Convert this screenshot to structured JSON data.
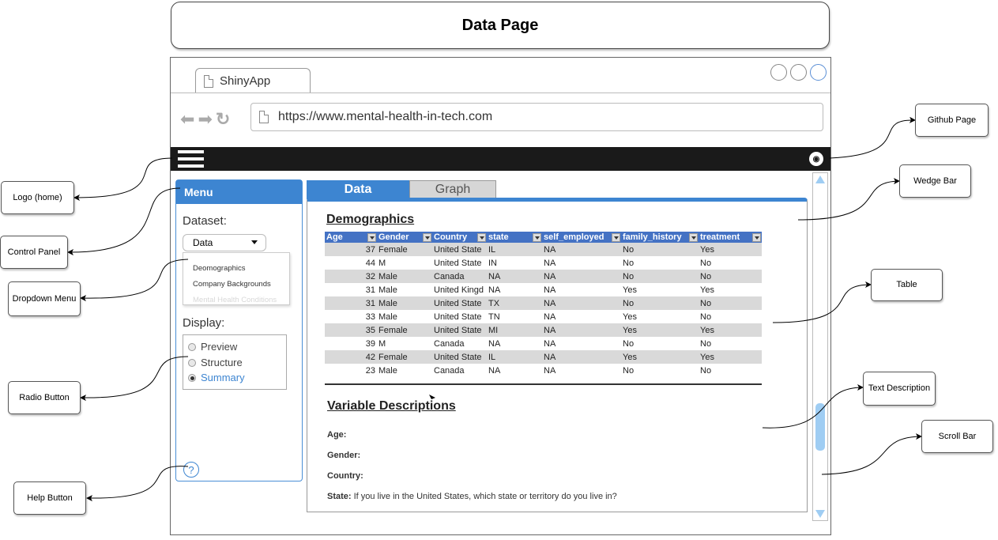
{
  "title": "Data Page",
  "browser": {
    "tab_label": "ShinyApp",
    "url": "https://www.mental-health-in-tech.com"
  },
  "menu": {
    "header": "Menu",
    "dataset_label": "Dataset:",
    "dataset_selected": "Data",
    "dropdown_options": [
      "Deomographics",
      "Company Backgrounds",
      "Mental Health Conditions"
    ],
    "display_label": "Display:",
    "radio_options": [
      "Preview",
      "Structure",
      "Summary"
    ],
    "radio_selected": "Summary",
    "help_symbol": "?"
  },
  "tabs": [
    "Data",
    "Graph"
  ],
  "active_tab": "Data",
  "demographics": {
    "title": "Demographics",
    "columns": [
      "Age",
      "Gender",
      "Country",
      "state",
      "self_employed",
      "family_history",
      "treatment"
    ],
    "rows": [
      [
        "37",
        "Female",
        "United State",
        "IL",
        "NA",
        "No",
        "Yes"
      ],
      [
        "44",
        "M",
        "United State",
        "IN",
        "NA",
        "No",
        "No"
      ],
      [
        "32",
        "Male",
        "Canada",
        "NA",
        "NA",
        "No",
        "No"
      ],
      [
        "31",
        "Male",
        "United Kingd",
        "NA",
        "NA",
        "Yes",
        "Yes"
      ],
      [
        "31",
        "Male",
        "United State",
        "TX",
        "NA",
        "No",
        "No"
      ],
      [
        "33",
        "Male",
        "United State",
        "TN",
        "NA",
        "Yes",
        "No"
      ],
      [
        "35",
        "Female",
        "United State",
        "MI",
        "NA",
        "Yes",
        "Yes"
      ],
      [
        "39",
        "M",
        "Canada",
        "NA",
        "NA",
        "No",
        "No"
      ],
      [
        "42",
        "Female",
        "United State",
        "IL",
        "NA",
        "Yes",
        "Yes"
      ],
      [
        "23",
        "Male",
        "Canada",
        "NA",
        "NA",
        "No",
        "No"
      ]
    ]
  },
  "variables": {
    "title": "Variable Descriptions",
    "items": [
      {
        "name": "Age",
        "desc": ""
      },
      {
        "name": "Gender",
        "desc": ""
      },
      {
        "name": "Country",
        "desc": ""
      },
      {
        "name": "State",
        "desc": "If you live in the United States, which state or territory do you live in?"
      }
    ]
  },
  "callouts": {
    "github_page": "Github Page",
    "wedge_bar": "Wedge Bar",
    "table": "Table",
    "text_description": "Text Description",
    "scroll_bar": "Scroll Bar",
    "logo_home": "Logo (home)",
    "control_panel": "Control Panel",
    "dropdown_menu": "Dropdown Menu",
    "radio_button": "Radio Button",
    "help_button": "Help Button"
  },
  "colors": {
    "accent": "#3d85d1",
    "table_header": "#4472c4",
    "scroll": "#9fcdf3",
    "topbar": "#1a1a1a"
  }
}
